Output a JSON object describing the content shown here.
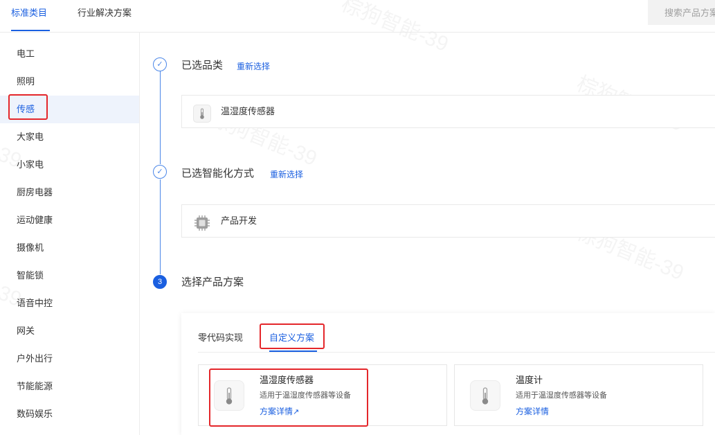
{
  "top_tabs": [
    {
      "label": "标准类目",
      "active": true
    },
    {
      "label": "行业解决方案",
      "active": false
    }
  ],
  "search": {
    "placeholder": "搜索产品方案"
  },
  "sidebar": {
    "items": [
      {
        "label": "电工"
      },
      {
        "label": "照明"
      },
      {
        "label": "传感",
        "active": true
      },
      {
        "label": "大家电"
      },
      {
        "label": "小家电"
      },
      {
        "label": "厨房电器"
      },
      {
        "label": "运动健康"
      },
      {
        "label": "摄像机"
      },
      {
        "label": "智能锁"
      },
      {
        "label": "语音中控"
      },
      {
        "label": "网关"
      },
      {
        "label": "户外出行"
      },
      {
        "label": "节能能源"
      },
      {
        "label": "数码娱乐"
      }
    ]
  },
  "steps": [
    {
      "title": "已选品类",
      "action": "重新选择",
      "selected": "温湿度传感器",
      "icon": "thermometer-icon",
      "status": "done"
    },
    {
      "title": "已选智能化方式",
      "action": "重新选择",
      "selected": "产品开发",
      "icon": "chip-icon",
      "status": "done"
    },
    {
      "title": "选择产品方案",
      "number": "3",
      "status": "current"
    }
  ],
  "solution": {
    "tabs": [
      {
        "label": "零代码实现",
        "active": false
      },
      {
        "label": "自定义方案",
        "active": true
      }
    ],
    "cards": [
      {
        "title": "温湿度传感器",
        "desc": "适用于温湿度传感器等设备",
        "link": "方案详情",
        "link_icon": "external-arrow-icon",
        "icon": "thermometer-icon"
      },
      {
        "title": "温度计",
        "desc": "适用于温湿度传感器等设备",
        "link": "方案详情",
        "icon": "thermometer-icon"
      }
    ]
  },
  "colors": {
    "accent": "#1a5fe0",
    "highlight": "#e4262a"
  }
}
